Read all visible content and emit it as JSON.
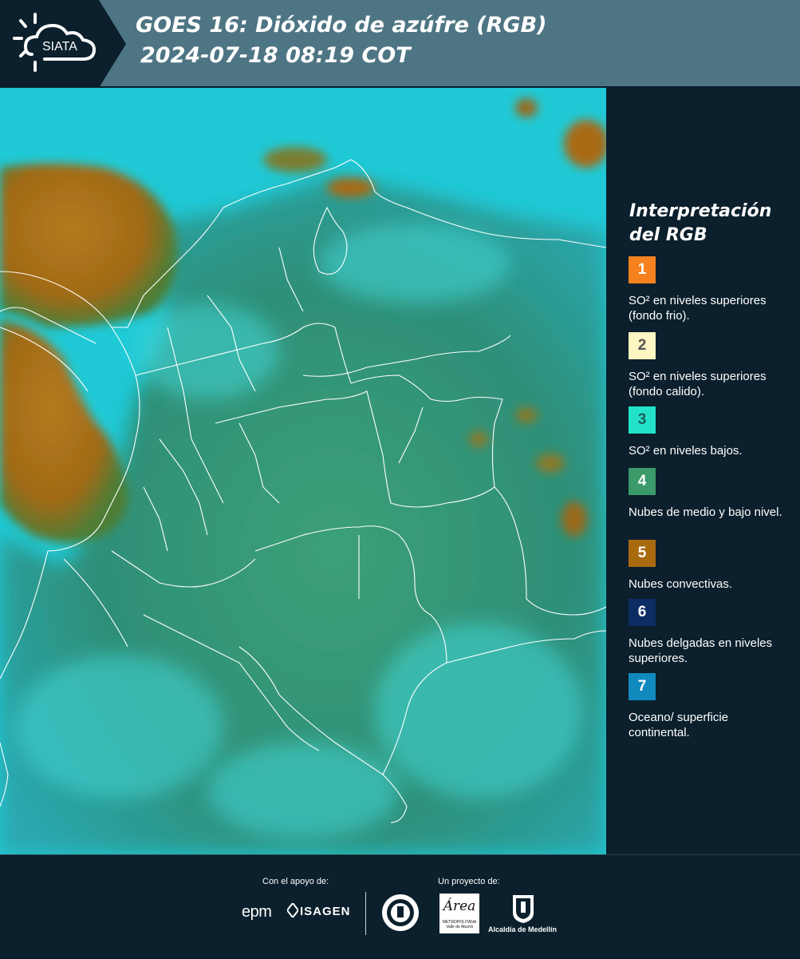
{
  "header": {
    "logo_text": "SIATA",
    "title_line1": "GOES 16: Dióxido de azúfre (RGB)",
    "title_line2": "2024-07-18 08:19 COT"
  },
  "legend": {
    "title": "Interpretación del RGB",
    "items": [
      {
        "number": "1",
        "color": "#f5821f",
        "text": "SO² en niveles superiores (fondo frio)."
      },
      {
        "number": "2",
        "color": "#fdf5c2",
        "text": "SO² en niveles superiores (fondo calido)."
      },
      {
        "number": "3",
        "color": "#22e3c9",
        "text": "SO² en niveles bajos."
      },
      {
        "number": "4",
        "color": "#3a9a6a",
        "text": "Nubes de medio y bajo nivel."
      },
      {
        "number": "5",
        "color": "#a9690e",
        "text": "Nubes convectivas."
      },
      {
        "number": "6",
        "color": "#0d2c63",
        "text": "Nubes delgadas en niveles superiores."
      },
      {
        "number": "7",
        "color": "#1089bd",
        "text": "Oceano/ superficie continental."
      }
    ]
  },
  "footer": {
    "support_label": "Con el apoyo de:",
    "project_label": "Un proyecto de:",
    "sponsor1": "epm",
    "sponsor2": "ISAGEN",
    "seal_icon": "medellin-seal-icon",
    "area_logo_text": "Área",
    "area_logo_sub": "METROPOLITANA Valle de Aburrá",
    "alcaldia_text": "Alcaldía de Medellín"
  },
  "map_colors": {
    "ocean": "#1fc9d6",
    "land_green": "#3a9a6a",
    "convective": "#a9690e",
    "borders": "#ffffff"
  }
}
